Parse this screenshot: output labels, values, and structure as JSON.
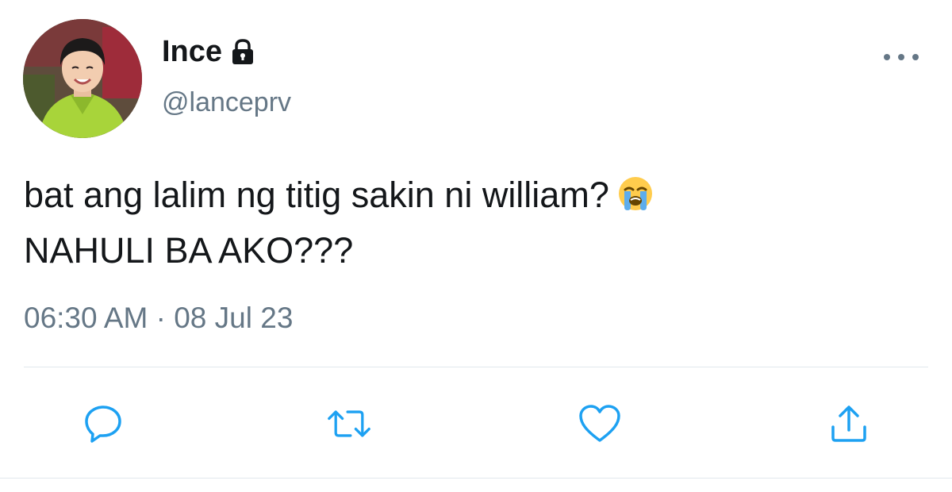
{
  "tweet": {
    "display_name": "Ince",
    "handle": "@lanceprv",
    "text_line1": "bat ang lalim ng titig sakin ni william?",
    "text_line2": "NAHULI BA AKO???",
    "emoji": "loudly-crying-face",
    "time": "06:30 AM",
    "separator": "·",
    "date": "08 Jul 23",
    "protected": true
  },
  "actions": {
    "reply": "reply-icon",
    "retweet": "retweet-icon",
    "like": "heart-icon",
    "share": "share-icon"
  },
  "colors": {
    "text": "#14171a",
    "secondary": "#657786",
    "action_icon": "#1da1f2",
    "divider": "#e1e8ed"
  }
}
